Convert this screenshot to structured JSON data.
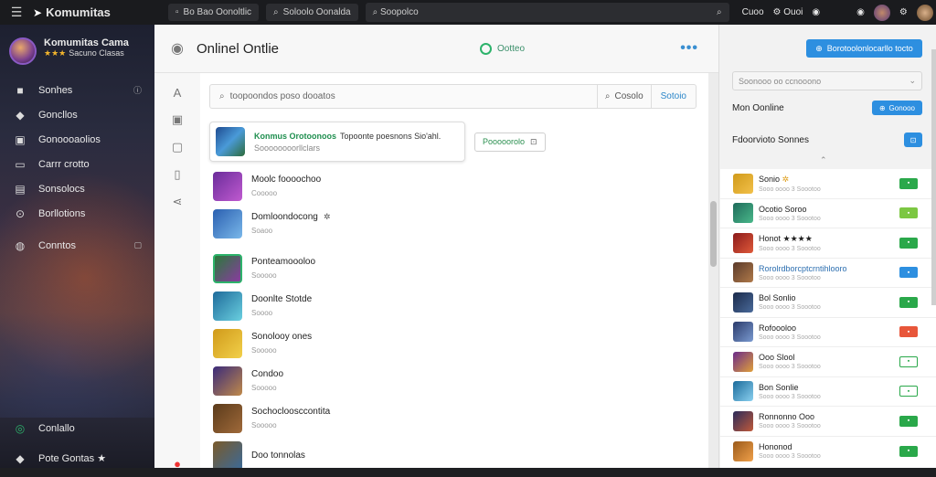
{
  "topbar": {
    "brand": "Komumitas",
    "pill1": "Bo Bao Oonoltlic",
    "pill2": "Soloolo Oonalda",
    "search_placeholder": "Soopolco",
    "link1": "Cuoo",
    "link2": "Ouoi"
  },
  "sidebar": {
    "profile_name": "Komumitas Cama",
    "profile_stars": "★★★",
    "profile_sub": "Sacuno Clasas",
    "items": [
      {
        "label": "Sonhes",
        "icon": "home-icon"
      },
      {
        "label": "Goncllos",
        "icon": "diamond-icon"
      },
      {
        "label": "Gonoooaolios",
        "icon": "library-icon"
      },
      {
        "label": "Carrr crotto",
        "icon": "monitor-icon"
      },
      {
        "label": "Sonsolocs",
        "icon": "folder-icon"
      },
      {
        "label": "Borllotions",
        "icon": "settings-icon"
      },
      {
        "label": "Conntos",
        "icon": "globe-icon"
      }
    ],
    "footer_items": [
      {
        "label": "Conlallo",
        "icon": "status-icon"
      },
      {
        "label": "Pote Gontas ★",
        "icon": "tag-icon"
      }
    ]
  },
  "main": {
    "title": "Onlinel Ontlie",
    "status": "Ootteo",
    "search_placeholder": "toopoondos poso dooatos",
    "btn_filter": "Cosolo",
    "btn_action": "Sotoio",
    "featured": {
      "name": "Konmus Orotoonoos",
      "desc": "Topoonte poesnons Sio'ahl.",
      "sub": "Soooooooorllclars",
      "button": "Pooooorolo"
    },
    "list": [
      {
        "name": "Moolc foooochoo",
        "sub": "Cooooo"
      },
      {
        "name": "Domloondocong",
        "sub": "Soaoo",
        "extra": "✲"
      },
      {
        "name": "Ponteamoooloo",
        "sub": "Sooooo"
      },
      {
        "name": "Doonlte Stotde",
        "sub": "Soooo"
      },
      {
        "name": "Sonolooy ones",
        "sub": "Sooooo"
      },
      {
        "name": "Condoo",
        "sub": "Sooooo"
      },
      {
        "name": "Sochocloosccontita",
        "sub": "Sooooo"
      },
      {
        "name": "Doo tonnolas",
        "sub": ""
      }
    ]
  },
  "right": {
    "top_button": "Borotoolonlocarllo tocto",
    "select": "Soonooo oo ccnooono",
    "row1_label": "Mon  Oonline",
    "row1_button": "Gonooo",
    "row2_label": "Fdoorvioto Sonnes",
    "items": [
      {
        "name": "Sonio",
        "sub": "Sooo oooo 3 Soootoo",
        "extra": "✲",
        "tag_color": "#2aa84a"
      },
      {
        "name": "Ocotio Soroo",
        "sub": "Sooo oooo 3 Soootoo",
        "tag_color": "#7cc742"
      },
      {
        "name": "Honot ★★★★",
        "sub": "Sooo oooo 3 Soootoo",
        "tag_color": "#2aa84a"
      },
      {
        "name": "Rorolrdborcptcrntihlooro",
        "sub": "Sooo oooo 3 Soootoo",
        "tag_color": "#2d8fe0"
      },
      {
        "name": "Bol Sonlio",
        "sub": "Sooo oooo 3 Soootoo",
        "tag_color": "#2aa84a"
      },
      {
        "name": "Rofoooloo",
        "sub": "Sooo oooo 3 Soootoo",
        "tag_color": "#e8563a"
      },
      {
        "name": "Ooo Slool",
        "sub": "Sooo oooo 3 Soootoo",
        "tag_color": "#2aa84a"
      },
      {
        "name": "Bon Sonlie",
        "sub": "Sooo oooo 3 Soootoo",
        "tag_color": "#2aa84a"
      },
      {
        "name": "Ronnonno Ooo",
        "sub": "Sooo oooo 3 Soootoo",
        "tag_color": "#2aa84a"
      },
      {
        "name": "Hononod",
        "sub": "Sooo oooo 3 Soootoo",
        "tag_color": "#2aa84a"
      }
    ]
  },
  "colors": {
    "accent": "#2d8fe0",
    "online": "#2db36b"
  }
}
